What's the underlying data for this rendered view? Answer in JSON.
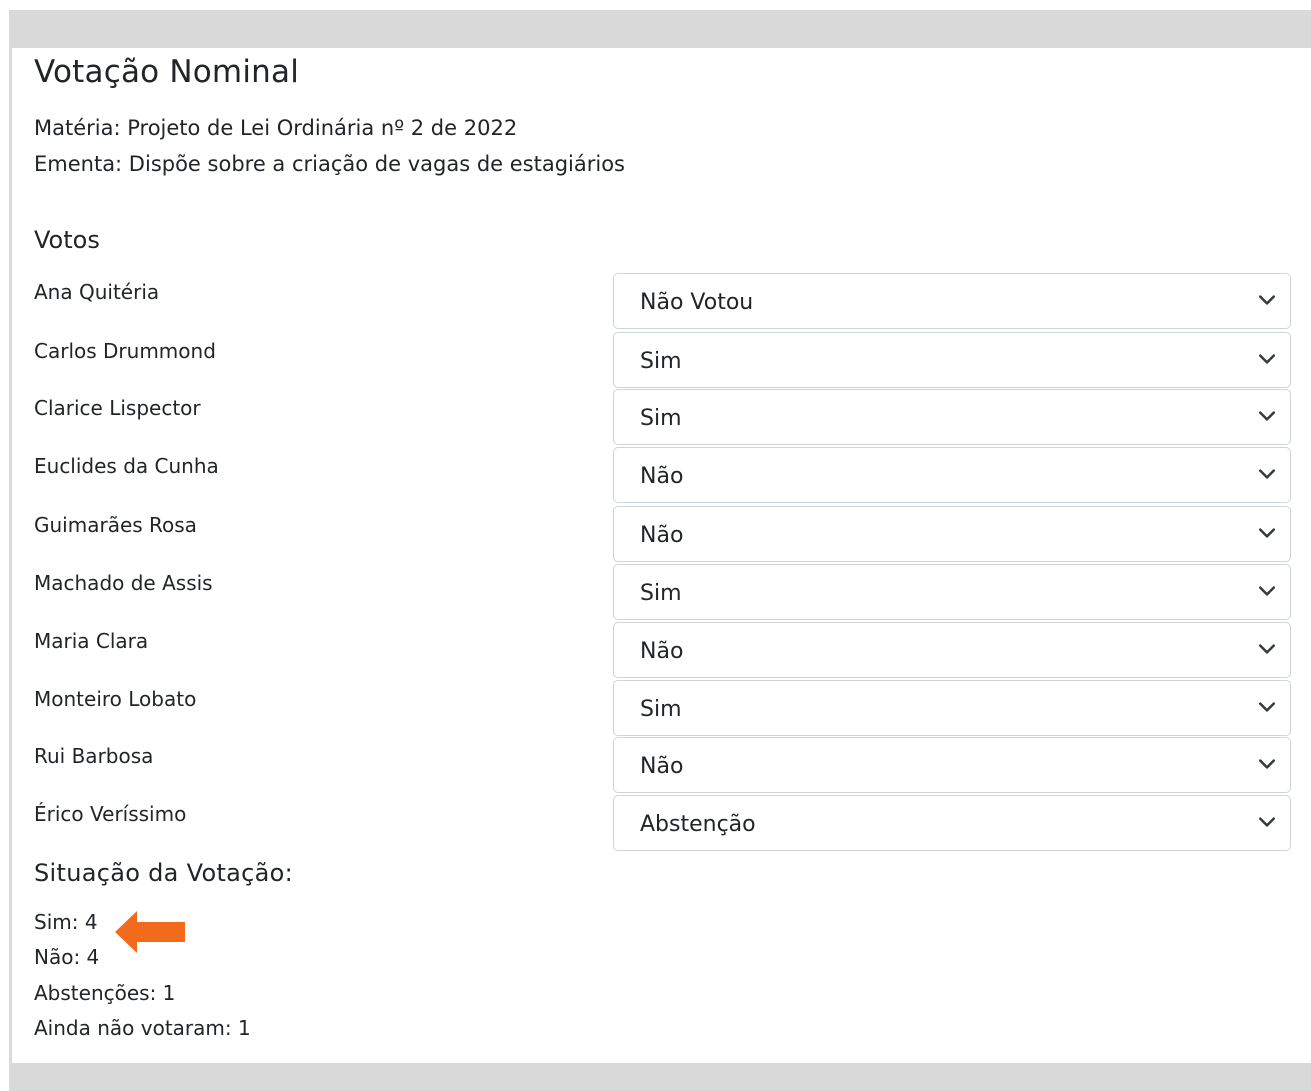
{
  "header": {
    "title": "Votação Nominal",
    "materia": "Matéria: Projeto de Lei Ordinária nº 2 de 2022",
    "ementa": "Ementa: Dispõe sobre a criação de vagas de estagiários"
  },
  "votes": {
    "section_title": "Votos",
    "rows": [
      {
        "name": "Ana Quitéria",
        "value": "Não Votou"
      },
      {
        "name": "Carlos Drummond",
        "value": "Sim"
      },
      {
        "name": "Clarice Lispector",
        "value": "Sim"
      },
      {
        "name": "Euclides da Cunha",
        "value": "Não"
      },
      {
        "name": "Guimarães Rosa",
        "value": "Não"
      },
      {
        "name": "Machado de Assis",
        "value": "Sim"
      },
      {
        "name": "Maria Clara",
        "value": "Não"
      },
      {
        "name": "Monteiro Lobato",
        "value": "Sim"
      },
      {
        "name": "Rui Barbosa",
        "value": "Não"
      },
      {
        "name": "Érico Veríssimo",
        "value": "Abstenção"
      }
    ]
  },
  "status": {
    "title": "Situação da Votação:",
    "sim": "Sim: 4",
    "nao": "Não: 4",
    "abstencoes": "Abstenções: 1",
    "ainda_nao_votaram": "Ainda não votaram: 1"
  },
  "colors": {
    "frame": "#d9d9d9",
    "select_border": "#ced4da",
    "arrow": "#f26a1b"
  },
  "icons": {
    "select_chevron": "chevron-down-icon",
    "annotation": "arrow-left-icon"
  }
}
